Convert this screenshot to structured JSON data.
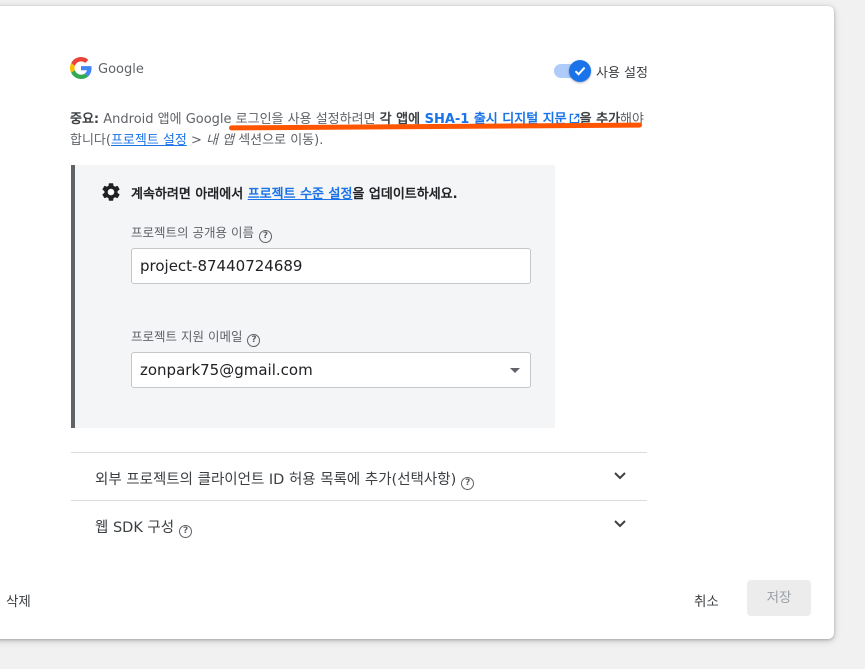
{
  "provider": {
    "name": "Google",
    "enabled": true,
    "toggle_label": "사용 설정"
  },
  "notice": {
    "lead": "중요:",
    "text1": " Android 앱에 Google 로그인을 사용 설정하려면 ",
    "strong": "각 앱에 ",
    "link_fingerprint": "SHA-1 출시 디지털 지문",
    "strong_after": "을 추가",
    "text2": "해야 합니다(",
    "link_settings": "프로젝트 설정",
    "text3": " > ",
    "italic": "내 앱",
    "text4": " 섹션으로 이동)."
  },
  "panel": {
    "title_prefix": "계속하려면 아래에서 ",
    "title_link": "프로젝트 수준 설정",
    "title_suffix": "을 업데이트하세요.",
    "public_name_label": "프로젝트의 공개용 이름",
    "public_name_value": "project-87440724689",
    "support_email_label": "프로젝트 지원 이메일",
    "support_email_value": "zonpark75@gmail.com"
  },
  "sections": [
    {
      "label": "외부 프로젝트의 클라이언트 ID 허용 목록에 추가(선택사항)"
    },
    {
      "label": "웹 SDK 구성"
    }
  ],
  "footer": {
    "delete_label": "삭제",
    "cancel_label": "취소",
    "save_label": "저장"
  },
  "colors": {
    "accent": "#1a73e8",
    "annotation": "#ff5500"
  }
}
